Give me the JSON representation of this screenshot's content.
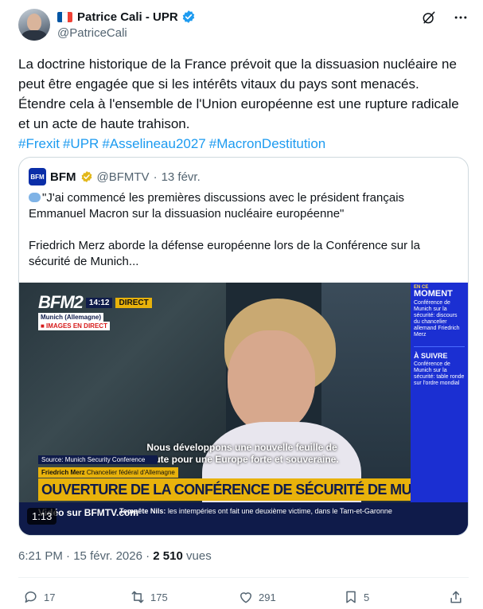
{
  "author": {
    "display_name": "Patrice Cali - UPR",
    "handle": "@PatriceCali",
    "flag_colors": [
      "#0055a4",
      "#ffffff",
      "#ef4135"
    ],
    "verified_color": "#1d9bf0"
  },
  "tweet": {
    "text": "La doctrine historique de la France prévoit que la dissuasion nucléaire ne peut être engagée que si les intérêts vitaux du pays sont menacés. Étendre cela à l'ensemble de l'Union européenne est une rupture radicale et un acte de haute trahison.",
    "hashtags": [
      "#Frexit",
      "#UPR",
      "#Asselineau2027",
      "#MacronDestitution"
    ],
    "hashtag_color": "#1d9bf0"
  },
  "quote": {
    "name": "BFM",
    "logo_text": "BFM",
    "handle": "@BFMTV",
    "separator": "·",
    "date": "13 févr.",
    "quote_text": "\"J'ai commencé les premières discussions avec le président français Emmanuel Macron sur la dissuasion nucléaire européenne\"",
    "body": "Friedrich Merz aborde la défense européenne lors de la Conférence sur la sécurité de Munich..."
  },
  "video": {
    "channel": "BFM2",
    "time": "14:12",
    "direct": "DIRECT",
    "location": "Munich (Allemagne)",
    "live": "■ IMAGES EN DIRECT",
    "side_kicker": "EN CE",
    "side_title": "MOMENT",
    "side_text_1": "Conférence de Munich sur la sécurité: discours du chancelier allemand Friedrich Merz",
    "side_heading": "À SUIVRE",
    "side_text_2": "Conférence de Munich sur la sécurité: table ronde sur l'ordre mondial",
    "subtitle": "Nous développons une nouvelle feuille de route pour une Europe forte et souveraine.",
    "source": "Source: Munich Security Conference",
    "speaker_name": "Friedrich Merz",
    "speaker_role": "Chancelier fédéral d'Allemagne",
    "headline": "OUVERTURE DE LA CONFÉRENCE DE SÉCURITÉ DE MUNICH",
    "ticker_left": "Vidéo sur BFMTV.com",
    "ticker_title": "Tempête Nils:",
    "ticker_text": "les intempéries ont fait une deuxième victime, dans le Tarn-et-Garonne",
    "duration": "1:13"
  },
  "meta": {
    "time": "6:21 PM",
    "separator": "·",
    "date": "15 févr. 2026",
    "separator2": "·",
    "views_count": "2 510",
    "views_label": "vues"
  },
  "actions": {
    "replies": "17",
    "reposts": "175",
    "likes": "291",
    "bookmarks": "5"
  }
}
